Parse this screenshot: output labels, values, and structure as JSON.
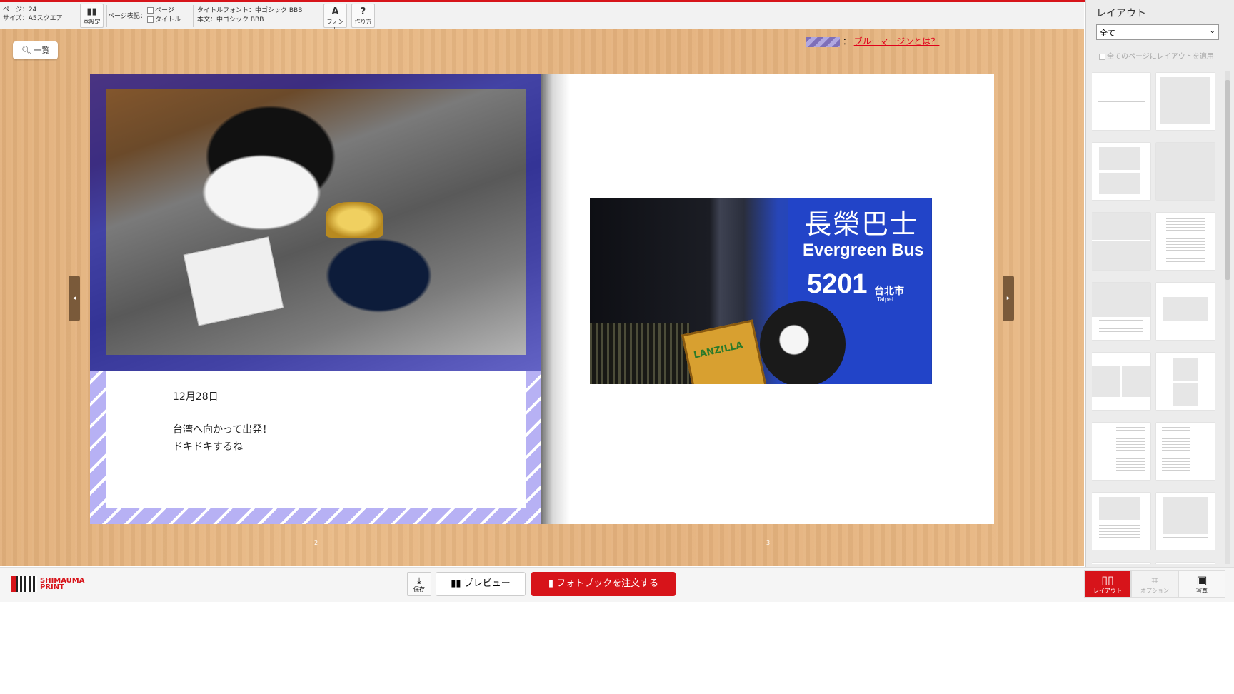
{
  "toolbar": {
    "page_info": "ページ：24",
    "size_info": "サイズ：A5スクエア",
    "settings_label": "本設定",
    "page_display_label": "ページ表記：",
    "check_page": "ページ",
    "check_title": "タイトル",
    "title_font": "タイトルフォント：中ゴシック BBB",
    "body_font": "本文：中ゴシック BBB",
    "font_label": "フォント",
    "help_label": "作り方"
  },
  "list_button": "一覧",
  "bleed_legend": {
    "separator": "：",
    "link": "ブルーマージンとは？"
  },
  "left_page": {
    "date": "12月28日",
    "line1": "台湾へ向かって出発！",
    "line2": "ドキドキするね",
    "page_number": "2"
  },
  "right_page": {
    "sign_chinese": "長榮巴士",
    "sign_english": "Evergreen Bus",
    "sign_number": "5201",
    "sign_city": "台北市",
    "sign_city_en": "Taipei",
    "card_title": "LANZILLA",
    "page_number": "3"
  },
  "bottom_bar": {
    "logo_text_1": "SHIMAUMA",
    "logo_text_2": "PRINT",
    "save_label": "保存",
    "preview_label": "プレビュー",
    "order_label": "フォトブックを注文する",
    "tabs": [
      {
        "label": "レイアウト",
        "state": "active"
      },
      {
        "label": "オプション",
        "state": "disabled"
      },
      {
        "label": "写真",
        "state": "normal"
      }
    ]
  },
  "sidebar": {
    "title": "レイアウト",
    "select_value": "全て",
    "apply_all_label": "全てのページにレイアウトを適用"
  },
  "colors": {
    "accent": "#d7141a",
    "bleed": "#b7b1f4"
  }
}
